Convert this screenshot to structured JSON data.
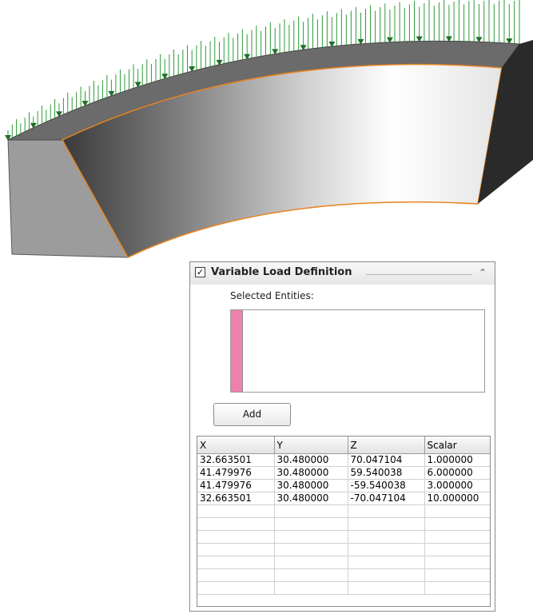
{
  "panel": {
    "title": "Variable Load Definition",
    "checkbox_mark": "✓",
    "collapse_glyph": "⌃",
    "selected_label": "Selected Entities:",
    "add_label": "Add",
    "selection_color": "#ee80b0",
    "columns": [
      "X",
      "Y",
      "Z",
      "Scalar"
    ],
    "rows": [
      [
        "32.663501",
        "30.480000",
        "70.047104",
        "1.000000"
      ],
      [
        "41.479976",
        "30.480000",
        "59.540038",
        "6.000000"
      ],
      [
        "41.479976",
        "30.480000",
        "-59.540038",
        "3.000000"
      ],
      [
        "32.663501",
        "30.480000",
        "-70.047104",
        "10.000000"
      ],
      [
        "",
        "",
        "",
        ""
      ],
      [
        "",
        "",
        "",
        ""
      ],
      [
        "",
        "",
        "",
        ""
      ],
      [
        "",
        "",
        "",
        ""
      ],
      [
        "",
        "",
        "",
        ""
      ],
      [
        "",
        "",
        "",
        ""
      ],
      [
        "",
        "",
        "",
        ""
      ]
    ]
  },
  "model": {
    "face_edge_color": "#e88420",
    "load_arrow_color": "#2e9a3a"
  }
}
